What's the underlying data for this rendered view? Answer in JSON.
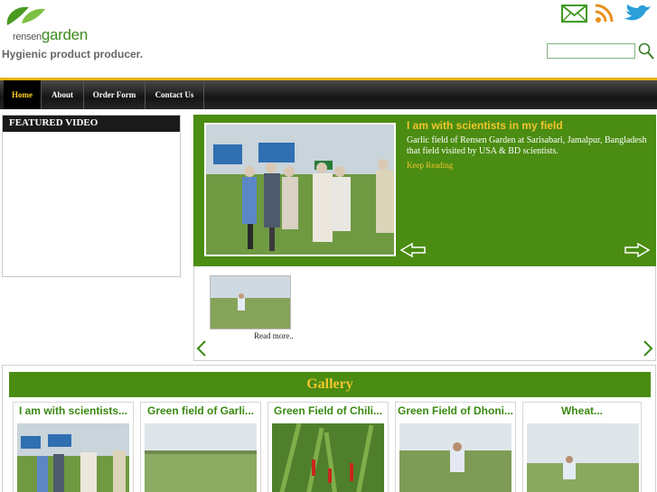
{
  "header": {
    "logo": {
      "prefix": "rensen",
      "word": "garden"
    },
    "tagline": "Hygienic product producer.",
    "icons": [
      "mail-icon",
      "rss-icon",
      "twitter-bird-icon"
    ],
    "search": {
      "value": "",
      "placeholder": ""
    }
  },
  "nav": {
    "items": [
      {
        "label": "Home",
        "active": true
      },
      {
        "label": "About",
        "active": false
      },
      {
        "label": "Order Form",
        "active": false
      },
      {
        "label": "Contact Us",
        "active": false
      }
    ]
  },
  "featured_video": {
    "title": "FEATURED VIDEO"
  },
  "slider": {
    "title": "I am with scientists in my field",
    "text": "Garlic field of Rensen Garden at Sarisabari, Jamalpur, Bangladesh that field visited by USA & BD scientists.",
    "more": "Keep Reading"
  },
  "thumbs": {
    "more": "Read more.."
  },
  "gallery": {
    "title": "Gallery",
    "items": [
      {
        "title": "I am with scientists..."
      },
      {
        "title": "Green field of Garli..."
      },
      {
        "title": "Green Field of Chili..."
      },
      {
        "title": "Green Field of Dhoni..."
      },
      {
        "title": "Wheat..."
      }
    ]
  },
  "colors": {
    "brand_green": "#4b8c12",
    "accent_yellow": "#f2c52c",
    "nav_border": "#e9b10c"
  }
}
